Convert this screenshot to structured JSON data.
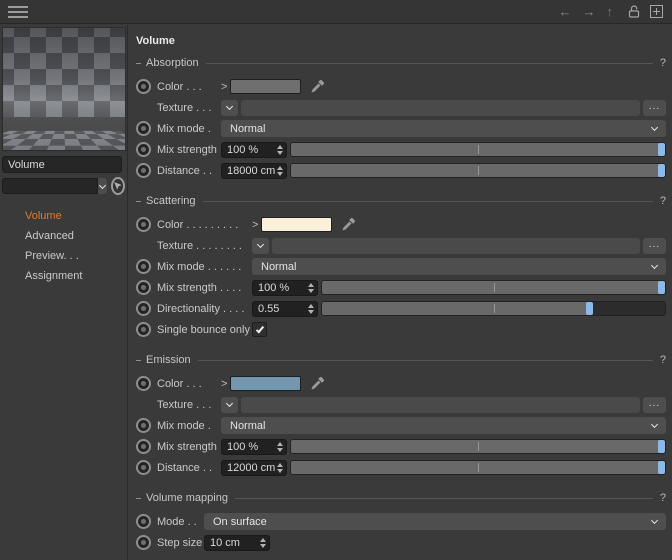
{
  "colors": {
    "accent_orange": "#e0772f",
    "slider_handle_blue": "#8db9e8",
    "absorption_swatch": "#6f6f6f",
    "scattering_swatch": "#fbf0d9",
    "emission_swatch": "#7496ae"
  },
  "titlebar": {
    "back_glyph": "←",
    "forward_glyph": "→",
    "up_glyph": "↑"
  },
  "sidebar": {
    "material_name": "Volume",
    "filter_value": "",
    "nav_items": [
      {
        "label": "Volume",
        "active": true
      },
      {
        "label": "Advanced",
        "active": false
      },
      {
        "label": "Preview. . .",
        "active": false
      },
      {
        "label": "Assignment",
        "active": false
      }
    ]
  },
  "panel": {
    "title": "Volume",
    "help_glyph": "?",
    "more_label": "...",
    "expand_glyph": ">",
    "sections": {
      "absorption": {
        "header": "Absorption",
        "color": {
          "label": "Color . . .",
          "swatch": "#6f6f6f"
        },
        "texture": {
          "label": "Texture . . .",
          "value": ""
        },
        "mix_mode": {
          "label": "Mix mode .",
          "value": "Normal"
        },
        "mix_strength": {
          "label": "Mix strength",
          "value": "100 %",
          "slider_pct": 100
        },
        "distance": {
          "label": "Distance . .",
          "value": "18000 cm",
          "slider_pct": 100
        }
      },
      "scattering": {
        "header": "Scattering",
        "color": {
          "label": "Color . . . . . . . . .",
          "swatch": "#fbf0d9"
        },
        "texture": {
          "label": "Texture . . . . . . . .",
          "value": ""
        },
        "mix_mode": {
          "label": "Mix mode . . . . . .",
          "value": "Normal"
        },
        "mix_strength": {
          "label": "Mix strength . . . .",
          "value": "100 %",
          "slider_pct": 100
        },
        "directionality": {
          "label": "Directionality . . . .",
          "value": "0.55",
          "slider_pct": 78
        },
        "single_bounce": {
          "label": "Single bounce only",
          "checked": true
        }
      },
      "emission": {
        "header": "Emission",
        "color": {
          "label": "Color . . .",
          "swatch": "#7496ae"
        },
        "texture": {
          "label": "Texture . . .",
          "value": ""
        },
        "mix_mode": {
          "label": "Mix mode .",
          "value": "Normal"
        },
        "mix_strength": {
          "label": "Mix strength",
          "value": "100 %",
          "slider_pct": 100
        },
        "distance": {
          "label": "Distance . .",
          "value": "12000 cm",
          "slider_pct": 100
        }
      },
      "volume_mapping": {
        "header": "Volume mapping",
        "mode": {
          "label": "Mode . .",
          "value": "On surface"
        },
        "step_size": {
          "label": "Step size",
          "value": "10 cm"
        }
      }
    }
  }
}
